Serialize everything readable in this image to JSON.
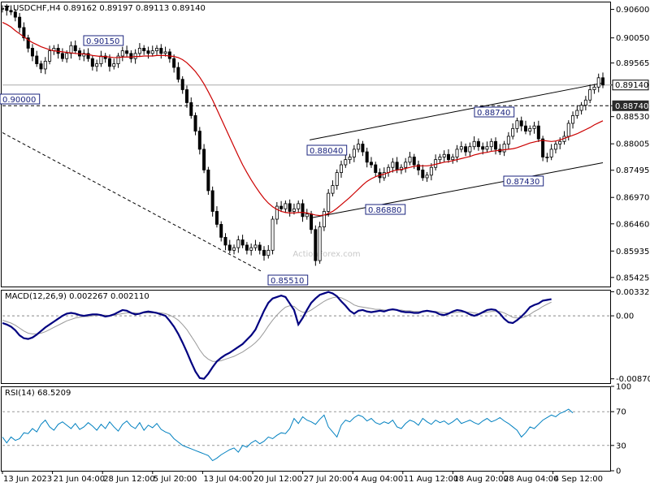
{
  "chart_data": [
    {
      "panel": "price",
      "type": "candlestick",
      "header": {
        "symbol": "USDCHF,H4",
        "open": "0.89162",
        "high": "0.89197",
        "low": "0.89113",
        "close": "0.89140"
      },
      "watermark": "ActionForex.com",
      "ylim": [
        0.8525,
        0.9075
      ],
      "y_ticks": [
        "0.90600",
        "0.90050",
        "0.89565",
        "0.89140",
        "0.88740",
        "0.88530",
        "0.88005",
        "0.87495",
        "0.86970",
        "0.86460",
        "0.85935",
        "0.85425"
      ],
      "current_price_label": "0.89140",
      "current_price": 0.8914,
      "horizontal_level": {
        "value": 0.8874,
        "label": "0.88740",
        "style": "dashed"
      },
      "x_ticks": [
        "13 Jun 2023",
        "21 Jun 04:00",
        "28 Jun 12:00",
        "5 Jul 20:00",
        "13 Jul 04:00",
        "20 Jul 12:00",
        "27 Jul 20:00",
        "4 Aug 04:00",
        "11 Aug 12:00",
        "18 Aug 20:00",
        "28 Aug 04:00",
        "4 Sep 12:00"
      ],
      "annotations": [
        {
          "text": "0.90150",
          "value": 0.9015
        },
        {
          "text": "0.85510",
          "value": 0.8551
        },
        {
          "text": "0.88040",
          "value": 0.8804
        },
        {
          "text": "0.86880",
          "value": 0.8688
        },
        {
          "text": "0.88740",
          "value": 0.8874
        },
        {
          "text": "0.87430",
          "value": 0.8743
        },
        {
          "text": "0.90000",
          "value": 0.9
        }
      ],
      "close_path": [
        0.9062,
        0.9058,
        0.9055,
        0.9045,
        0.9025,
        0.9005,
        0.8985,
        0.897,
        0.8955,
        0.8945,
        0.896,
        0.898,
        0.8985,
        0.8975,
        0.8965,
        0.8975,
        0.899,
        0.898,
        0.897,
        0.8975,
        0.8965,
        0.895,
        0.8955,
        0.897,
        0.8965,
        0.895,
        0.8955,
        0.897,
        0.898,
        0.8975,
        0.8965,
        0.8975,
        0.8985,
        0.898,
        0.8975,
        0.898,
        0.8985,
        0.8975,
        0.8978,
        0.8965,
        0.8948,
        0.8925,
        0.8905,
        0.888,
        0.8855,
        0.8825,
        0.879,
        0.875,
        0.871,
        0.867,
        0.8645,
        0.862,
        0.8605,
        0.8595,
        0.86,
        0.8615,
        0.8605,
        0.8595,
        0.86,
        0.8605,
        0.8595,
        0.8585,
        0.8595,
        0.8655,
        0.868,
        0.8675,
        0.8685,
        0.867,
        0.8675,
        0.8685,
        0.866,
        0.8665,
        0.8635,
        0.8575,
        0.864,
        0.867,
        0.8705,
        0.872,
        0.8745,
        0.876,
        0.877,
        0.8775,
        0.879,
        0.88,
        0.8785,
        0.8765,
        0.876,
        0.8745,
        0.8735,
        0.8745,
        0.8755,
        0.8765,
        0.875,
        0.8755,
        0.8765,
        0.8775,
        0.876,
        0.875,
        0.8735,
        0.874,
        0.8755,
        0.877,
        0.8775,
        0.878,
        0.877,
        0.8775,
        0.879,
        0.8795,
        0.8785,
        0.8795,
        0.8805,
        0.8795,
        0.879,
        0.8795,
        0.8805,
        0.879,
        0.8785,
        0.88,
        0.8815,
        0.883,
        0.8845,
        0.8835,
        0.8825,
        0.883,
        0.8835,
        0.881,
        0.8775,
        0.8775,
        0.879,
        0.88,
        0.8805,
        0.8815,
        0.884,
        0.8855,
        0.8865,
        0.8875,
        0.8885,
        0.8905,
        0.891,
        0.8928,
        0.8914
      ],
      "series": [
        {
          "name": "",
          "color": "#cc0000",
          "values": [
            0.9035,
            0.9031,
            0.9026,
            0.9019,
            0.9013,
            0.9007,
            0.9001,
            0.8996,
            0.8992,
            0.8988,
            0.8985,
            0.8982,
            0.898,
            0.8979,
            0.8978,
            0.8977,
            0.8976,
            0.8975,
            0.8974,
            0.8974,
            0.8973,
            0.8971,
            0.897,
            0.8969,
            0.8969,
            0.8968,
            0.8967,
            0.8967,
            0.8968,
            0.8968,
            0.8968,
            0.8969,
            0.8969,
            0.897,
            0.897,
            0.897,
            0.8971,
            0.8971,
            0.8971,
            0.897,
            0.8969,
            0.8967,
            0.8963,
            0.8957,
            0.8949,
            0.894,
            0.8929,
            0.8916,
            0.8901,
            0.8885,
            0.8867,
            0.8849,
            0.8831,
            0.8813,
            0.8795,
            0.8777,
            0.876,
            0.8745,
            0.8731,
            0.8718,
            0.8706,
            0.8695,
            0.8686,
            0.8679,
            0.8674,
            0.867,
            0.8668,
            0.8667,
            0.8667,
            0.8668,
            0.8668,
            0.8667,
            0.8665,
            0.8663,
            0.8662,
            0.8663,
            0.8666,
            0.867,
            0.8676,
            0.8683,
            0.869,
            0.8697,
            0.8705,
            0.8713,
            0.8721,
            0.8728,
            0.8733,
            0.8737,
            0.874,
            0.8742,
            0.8745,
            0.8748,
            0.875,
            0.8751,
            0.8753,
            0.8755,
            0.8757,
            0.8758,
            0.8758,
            0.8758,
            0.8759,
            0.8761,
            0.8763,
            0.8765,
            0.8766,
            0.8768,
            0.877,
            0.8772,
            0.8774,
            0.8776,
            0.8779,
            0.8781,
            0.8783,
            0.8784,
            0.8786,
            0.8787,
            0.8788,
            0.8789,
            0.879,
            0.8791,
            0.8793,
            0.8796,
            0.8799,
            0.8802,
            0.8804,
            0.8806,
            0.8807,
            0.8806,
            0.8805,
            0.8806,
            0.8808,
            0.8811,
            0.8814,
            0.8817,
            0.882,
            0.8824,
            0.8828,
            0.8832,
            0.8837,
            0.8841,
            0.8845
          ]
        }
      ],
      "lines": [
        {
          "name": "channel-upper",
          "from": {
            "x": "27 Jul 2023",
            "y": 0.8808
          },
          "to": {
            "x": "7 Sep 2023",
            "y": 0.8918
          },
          "style": "solid"
        },
        {
          "name": "channel-lower",
          "from": {
            "x": "27 Jul 2023",
            "y": 0.8657
          },
          "to": {
            "x": "7 Sep 2023",
            "y": 0.8764
          },
          "style": "solid"
        },
        {
          "name": "falling-trendline",
          "from": {
            "x": "13 Jun 2023",
            "y": 0.8822
          },
          "to": {
            "x": "20 Jul 2023",
            "y": 0.8555
          },
          "style": "dashed"
        }
      ]
    },
    {
      "panel": "macd",
      "type": "line",
      "title": "MACD(12,26,9) 0.002267 0.002110",
      "ylim": [
        -0.0093,
        0.0036
      ],
      "y_ticks": [
        "0.003328",
        "0.00",
        "-0.008707"
      ],
      "y_tick_values": [
        0.003328,
        0.0,
        -0.008707
      ],
      "zero_line": "dashed",
      "series": [
        {
          "name": "MACD",
          "color": "#000080",
          "values": [
            -0.001,
            -0.0012,
            -0.0015,
            -0.002,
            -0.0027,
            -0.0031,
            -0.0032,
            -0.003,
            -0.0026,
            -0.0021,
            -0.0016,
            -0.0012,
            -0.0008,
            -0.0004,
            0.0,
            0.0003,
            0.0004,
            0.0003,
            0.0001,
            0.0,
            0.0001,
            0.0002,
            0.0002,
            0.0001,
            -0.0001,
            0.0,
            0.0002,
            0.0005,
            0.0008,
            0.0007,
            0.0004,
            0.0002,
            0.0003,
            0.0005,
            0.0006,
            0.0005,
            0.0004,
            0.0002,
            0.0,
            -0.0007,
            -0.0015,
            -0.0025,
            -0.0037,
            -0.005,
            -0.0064,
            -0.0077,
            -0.0086,
            -0.0087,
            -0.008,
            -0.0071,
            -0.0063,
            -0.0058,
            -0.0054,
            -0.0051,
            -0.0047,
            -0.0043,
            -0.0039,
            -0.0033,
            -0.0027,
            -0.0019,
            -0.0006,
            0.0007,
            0.0018,
            0.0024,
            0.0026,
            0.0028,
            0.0026,
            0.0017,
            0.0008,
            -0.0012,
            -0.0003,
            0.0008,
            0.0018,
            0.0024,
            0.0029,
            0.0031,
            0.0033,
            0.0031,
            0.0027,
            0.002,
            0.0014,
            0.0007,
            0.0003,
            0.0007,
            0.0008,
            0.0006,
            0.0005,
            0.0006,
            0.0007,
            0.0006,
            0.0008,
            0.0009,
            0.0008,
            0.0006,
            0.0005,
            0.0005,
            0.0004,
            0.0004,
            0.0006,
            0.0007,
            0.0006,
            0.0005,
            0.0002,
            0.0001,
            0.0003,
            0.0006,
            0.0008,
            0.0007,
            0.0005,
            0.0002,
            0.0,
            0.0002,
            0.0005,
            0.0008,
            0.0009,
            0.0008,
            0.0003,
            -0.0004,
            -0.0009,
            -0.001,
            -0.0006,
            -0.0001,
            0.0005,
            0.0012,
            0.0015,
            0.0017,
            0.0021,
            0.0022,
            0.0023
          ]
        },
        {
          "name": "Signal",
          "color": "#999999",
          "values": [
            -0.0006,
            -0.0008,
            -0.001,
            -0.0013,
            -0.0017,
            -0.0021,
            -0.0024,
            -0.0025,
            -0.0025,
            -0.0024,
            -0.0022,
            -0.0019,
            -0.0016,
            -0.0013,
            -0.001,
            -0.0007,
            -0.0005,
            -0.0003,
            -0.0002,
            -0.0001,
            -0.0001,
            0.0,
            0.0001,
            0.0001,
            0.0001,
            0.0,
            0.0001,
            0.0002,
            0.0003,
            0.0004,
            0.0004,
            0.0004,
            0.0003,
            0.0004,
            0.0004,
            0.0004,
            0.0004,
            0.0004,
            0.0003,
            0.0001,
            -0.0002,
            -0.0006,
            -0.0012,
            -0.0019,
            -0.0028,
            -0.0037,
            -0.0047,
            -0.0055,
            -0.006,
            -0.0063,
            -0.0063,
            -0.0062,
            -0.006,
            -0.0058,
            -0.0056,
            -0.0053,
            -0.005,
            -0.0046,
            -0.0042,
            -0.0037,
            -0.0031,
            -0.0023,
            -0.0014,
            -0.0006,
            0.0001,
            0.0007,
            0.0012,
            0.0014,
            0.0013,
            0.0008,
            0.0005,
            0.0005,
            0.0008,
            0.0012,
            0.0016,
            0.002,
            0.0023,
            0.0025,
            0.0026,
            0.0025,
            0.0022,
            0.0019,
            0.0015,
            0.0013,
            0.0012,
            0.0011,
            0.001,
            0.0009,
            0.0009,
            0.0008,
            0.0008,
            0.0008,
            0.0008,
            0.0008,
            0.0007,
            0.0007,
            0.0006,
            0.0006,
            0.0006,
            0.0006,
            0.0006,
            0.0006,
            0.0005,
            0.0004,
            0.0004,
            0.0004,
            0.0005,
            0.0005,
            0.0005,
            0.0005,
            0.0004,
            0.0003,
            0.0004,
            0.0005,
            0.0006,
            0.0006,
            0.0006,
            0.0004,
            0.0001,
            -0.0002,
            -0.0003,
            -0.0003,
            -0.0001,
            0.0002,
            0.0006,
            0.0009,
            0.0013,
            0.0016,
            0.0019
          ]
        }
      ]
    },
    {
      "panel": "rsi",
      "type": "line",
      "title": "RSI(14) 68.5209",
      "ylim": [
        0,
        100
      ],
      "y_ticks": [
        "100",
        "70",
        "30",
        "0"
      ],
      "y_tick_values": [
        100,
        70,
        30,
        0
      ],
      "levels": [
        70,
        30
      ],
      "series": [
        {
          "name": "RSI",
          "color": "#0080c0",
          "values": [
            40,
            33,
            40,
            36,
            38,
            45,
            44,
            50,
            46,
            55,
            60,
            52,
            48,
            55,
            58,
            54,
            50,
            56,
            49,
            52,
            57,
            53,
            48,
            55,
            50,
            58,
            52,
            47,
            55,
            59,
            53,
            50,
            57,
            48,
            54,
            51,
            56,
            49,
            46,
            44,
            38,
            34,
            30,
            28,
            26,
            24,
            22,
            20,
            18,
            12,
            15,
            19,
            22,
            25,
            27,
            22,
            30,
            28,
            33,
            36,
            32,
            35,
            40,
            38,
            42,
            45,
            44,
            50,
            62,
            56,
            64,
            60,
            58,
            55,
            61,
            66,
            52,
            46,
            40,
            54,
            60,
            58,
            63,
            66,
            64,
            59,
            62,
            57,
            55,
            58,
            56,
            60,
            52,
            50,
            56,
            60,
            58,
            54,
            62,
            58,
            55,
            60,
            57,
            59,
            55,
            58,
            62,
            56,
            58,
            60,
            57,
            55,
            59,
            62,
            58,
            60,
            63,
            59,
            56,
            52,
            48,
            40,
            45,
            52,
            50,
            55,
            60,
            63,
            66,
            64,
            68,
            70,
            73,
            68.5
          ]
        }
      ]
    }
  ]
}
